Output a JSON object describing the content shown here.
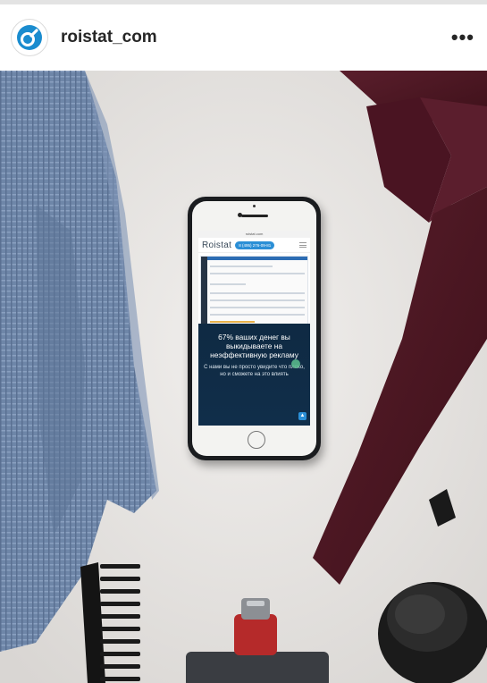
{
  "header": {
    "username": "roistat_com",
    "more_glyph": "•••"
  },
  "colors": {
    "brand_blue": "#1a8ccf",
    "header_text": "#262626"
  },
  "icons": {
    "avatar": "roistat-logo-icon",
    "more": "more-options-icon"
  },
  "phone_screen": {
    "url": "roistat.com",
    "logo": "Roistat",
    "phone_number": "8 (495) 276-09-81",
    "headline": "67% ваших денег вы выкидываете на неэффективную рекламу",
    "subline": "С нами вы не просто увидите что плохо, но и сможете на это влиять"
  }
}
